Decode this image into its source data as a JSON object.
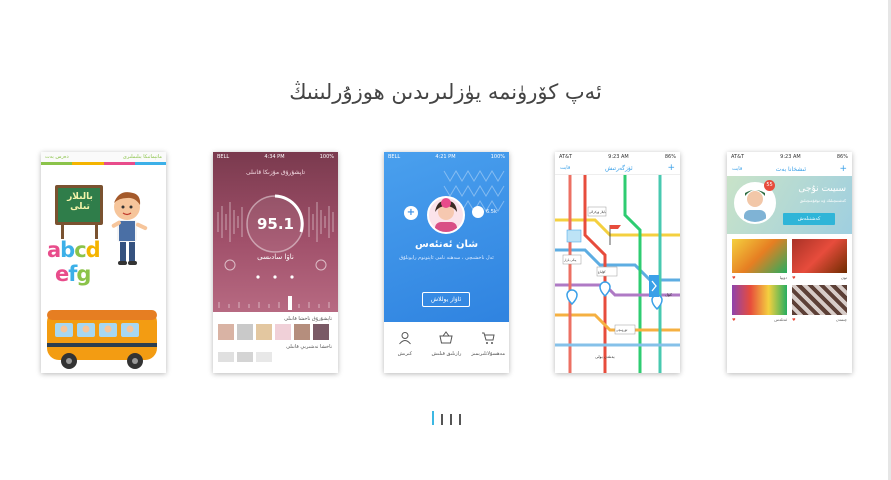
{
  "title": "ئەپ كۆرۈنمە يۈزلىرىدىن ھوزۇرلىنىڭ",
  "pager": {
    "count": 4,
    "active": 0
  },
  "card1": {
    "top_left": "دەرس بەت",
    "top_right": "ماتېماتىكا بىلىملىرى",
    "board_text": "بالىلار تىلى",
    "letters_line1": "abcd",
    "letters_line2": "efg",
    "letter_colors": [
      "#e84c8b",
      "#3cb0e8",
      "#8bc34a",
      "#f4b400",
      "#e84c8b",
      "#3cb0e8",
      "#8bc34a"
    ]
  },
  "card2": {
    "status_left": "BELL",
    "status_time": "4:34 PM",
    "status_right": "100%",
    "header": "تاپشۇرۇق مۇزىكا قانىلى",
    "frequency": "95.1",
    "station": "ناۋا سادىسى",
    "list_title": "تاپشۇرۇق ناخشا قانىلى",
    "list_title2": "ناخشا نەشىرىي قانىلى"
  },
  "card3": {
    "status_left": "BELL",
    "status_time": "4:21 PM",
    "status_right": "100%",
    "follow_count": "6.5k",
    "name": "شان ئەنئەس",
    "bio": "ئەل ناخشىچى ، سەھنە نامى ئاپتونوم رايونلۇق",
    "button": "ئاۋاز يوللاش",
    "tabs": [
      "كىرىش",
      "رازىلىق قىلىش",
      "مەھسۇلاتلىرىمىز"
    ]
  },
  "card4": {
    "status_left": "AT&T",
    "status_time": "9:23 AM",
    "status_right": "86%",
    "header_left": "قايت",
    "header_title": "ئۆزگەرتىش",
    "header_right": "+",
    "stations": [
      "بايلار ۋوكزالى",
      "يېڭى بازار",
      "گۇلباغ",
      "ئۆرۈمچى"
    ],
    "label_right": "كۆل",
    "label_bottom": "يەنئەن يولى"
  },
  "card5": {
    "status_left": "AT&T",
    "status_time": "9:23 AM",
    "status_right": "86%",
    "header_left": "قايت",
    "header_title": "ئىشخانا بەت",
    "header_right": "+",
    "badge": "55",
    "profile_name": "سىيىت نۇجى",
    "profile_sub": "كەشتىچىلىك ۋە توقۇمىچىلىق",
    "profile_button": "كەشتىلەش",
    "items": [
      "دوپپا",
      "تون",
      "ئەتلەس",
      "چىمەن"
    ]
  }
}
